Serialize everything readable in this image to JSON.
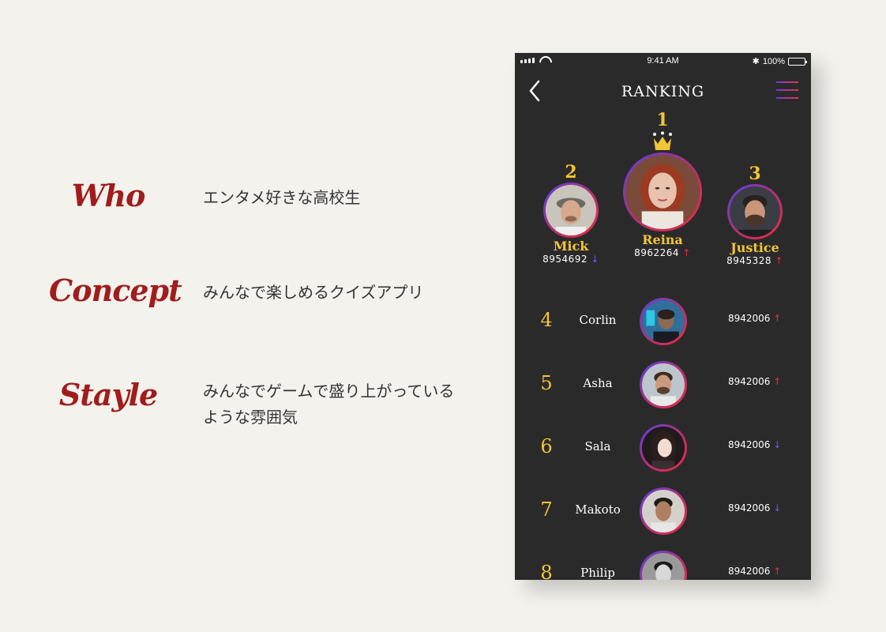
{
  "concept": [
    {
      "key": "Who",
      "value": "エンタメ好きな高校生"
    },
    {
      "key": "Concept",
      "value": "みんなで楽しめるクイズアプリ"
    },
    {
      "key": "Stayle",
      "value": "みんなでゲームで盛り上がっているような雰囲気"
    }
  ],
  "status_bar": {
    "time": "9:41 AM",
    "battery": "100%"
  },
  "header": {
    "title": "RANKING"
  },
  "podium": [
    {
      "rank": "2",
      "name": "Mick",
      "score": "8954692",
      "trend": "down"
    },
    {
      "rank": "1",
      "name": "Reina",
      "score": "8962264",
      "trend": "up"
    },
    {
      "rank": "3",
      "name": "Justice",
      "score": "8945328",
      "trend": "up"
    }
  ],
  "ranking_list": [
    {
      "rank": "4",
      "name": "Corlin",
      "score": "8942006",
      "trend": "up"
    },
    {
      "rank": "5",
      "name": "Asha",
      "score": "8942006",
      "trend": "up"
    },
    {
      "rank": "6",
      "name": "Sala",
      "score": "8942006",
      "trend": "down"
    },
    {
      "rank": "7",
      "name": "Makoto",
      "score": "8942006",
      "trend": "down"
    },
    {
      "rank": "8",
      "name": "Philip",
      "score": "8942006",
      "trend": "up"
    }
  ],
  "icons": {
    "up": "↑",
    "down": "↓"
  },
  "colors": {
    "accent_gold": "#f4c534",
    "brand_red": "#a11c1c",
    "gradient_start": "#5b3fe6",
    "gradient_end": "#ef2b3e",
    "phone_bg": "#2b2a2b"
  }
}
